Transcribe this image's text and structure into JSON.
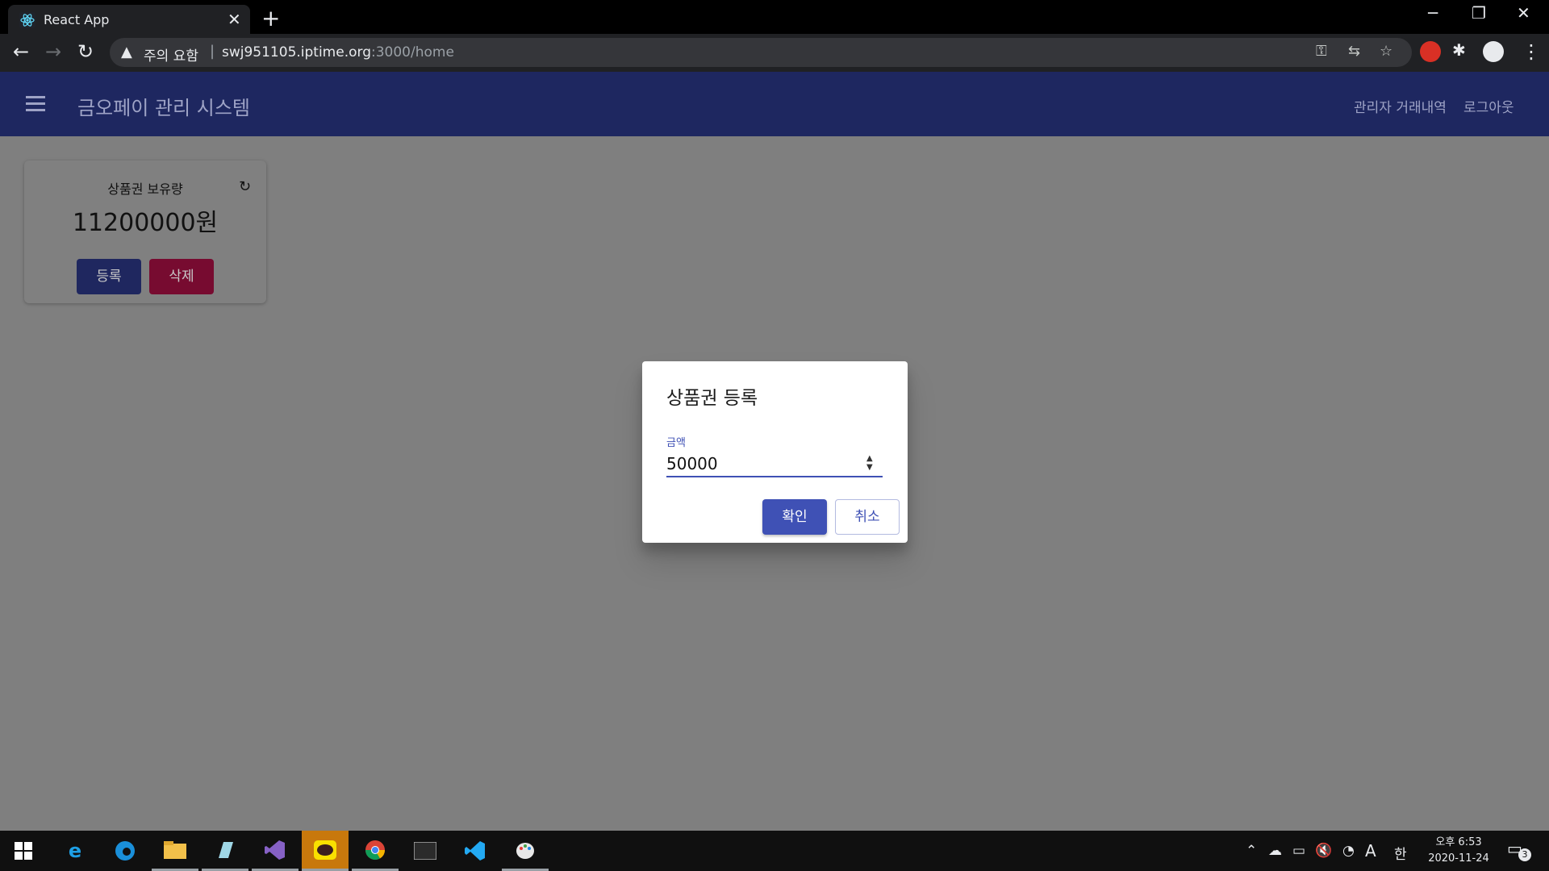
{
  "browser": {
    "tab_title": "React App",
    "new_tab": "+",
    "security_warning": "주의 요함",
    "separator": "|",
    "url_host": "swj951105.iptime.org",
    "url_rest": ":3000/home",
    "controls": {
      "minimize": "─",
      "restore": "❐",
      "close": "✕"
    }
  },
  "app": {
    "title": "금오페이 관리 시스템",
    "nav": {
      "history": "관리자 거래내역",
      "logout": "로그아웃"
    }
  },
  "card": {
    "label": "상품권 보유량",
    "amount": "11200000원",
    "register": "등록",
    "delete": "삭제"
  },
  "dialog": {
    "title": "상품권 등록",
    "field_label": "금액",
    "field_value": "50000",
    "confirm": "확인",
    "cancel": "취소"
  },
  "taskbar": {
    "ime_mode": "A",
    "language": "한",
    "time": "오후 6:53",
    "date": "2020-11-24",
    "notification_count": "3"
  },
  "colors": {
    "appbar": "#1e2760",
    "primary": "#3f51b5",
    "danger": "#770b30",
    "overlay": "#7f7f7f"
  }
}
